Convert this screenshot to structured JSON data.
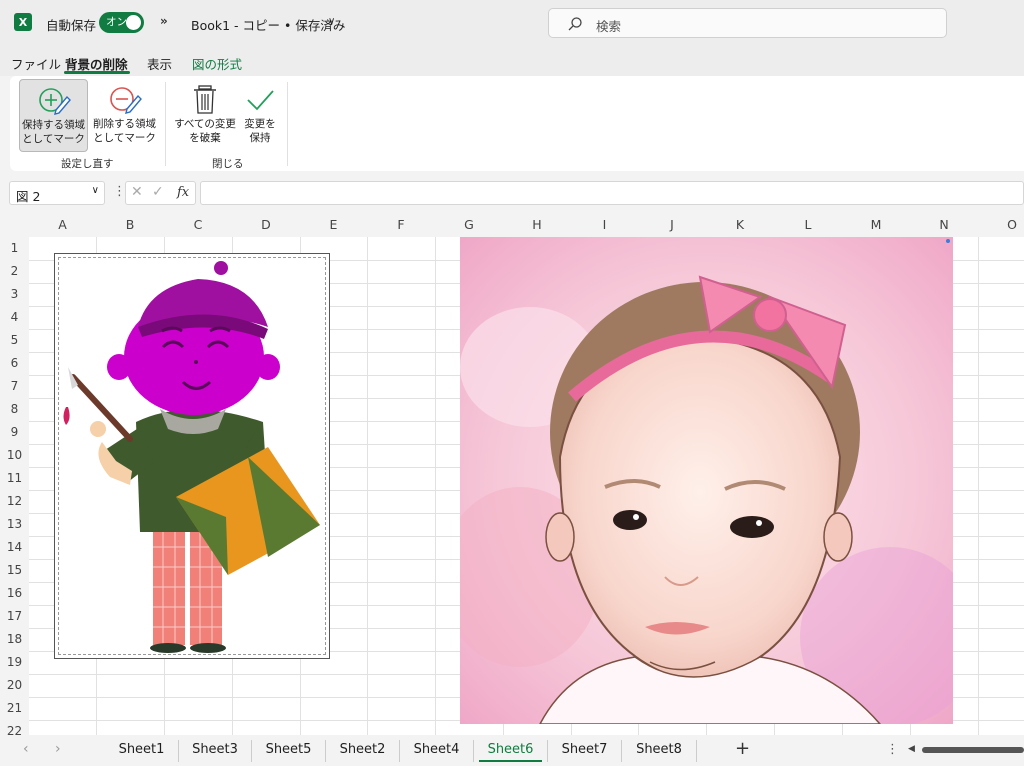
{
  "titlebar": {
    "app_icon": "excel-logo-icon",
    "app_letter": "X",
    "autosave_label": "自動保存",
    "autosave_state": "オン",
    "more_icon": "double-chevron-icon",
    "more_glyph": "»",
    "doc_title": "Book1 - コピー • 保存済み",
    "doc_caret": "∨",
    "search_placeholder": "検索"
  },
  "menu": {
    "tabs": [
      {
        "label": "ファイル"
      },
      {
        "label": "背景の削除"
      },
      {
        "label": "表示"
      },
      {
        "label": "図の形式"
      }
    ],
    "active_tab": "背景の削除"
  },
  "ribbon": {
    "mark_keep_line1": "保持する領域",
    "mark_keep_line2": "としてマーク",
    "mark_remove_line1": "削除する領域",
    "mark_remove_line2": "としてマーク",
    "group_refine": "設定し直す",
    "discard_line1": "すべての変更",
    "discard_line2": "を破棄",
    "keep_line1": "変更を",
    "keep_line2": "保持",
    "group_close": "閉じる",
    "accent": "#107c41"
  },
  "formula_bar": {
    "name_box": "図 2",
    "dots": "⋮",
    "cancel_glyph": "✕",
    "confirm_glyph": "✓",
    "fx_label": "fx",
    "value": ""
  },
  "grid": {
    "columns": [
      "A",
      "B",
      "C",
      "D",
      "E",
      "F",
      "G",
      "H",
      "I",
      "J",
      "K",
      "L",
      "M",
      "N",
      "O"
    ],
    "rows": [
      "1",
      "2",
      "3",
      "4",
      "5",
      "6",
      "7",
      "8",
      "9",
      "10",
      "11",
      "12",
      "13",
      "14",
      "15",
      "16",
      "17",
      "18",
      "19",
      "20",
      "21",
      "22"
    ]
  },
  "images": [
    {
      "name": "図 2",
      "subject": "illustration-painter-boy"
    },
    {
      "name": "baby-portrait",
      "subject": "watercolor-baby-with-pink-bow"
    }
  ],
  "sheets": {
    "tabs": [
      "Sheet1",
      "Sheet3",
      "Sheet5",
      "Sheet2",
      "Sheet4",
      "Sheet6",
      "Sheet7",
      "Sheet8"
    ],
    "active": "Sheet6",
    "add_glyph": "+",
    "prev_glyph": "‹",
    "next_glyph": "›",
    "menu_glyph": "⋮",
    "scroll_left_glyph": "◀"
  }
}
